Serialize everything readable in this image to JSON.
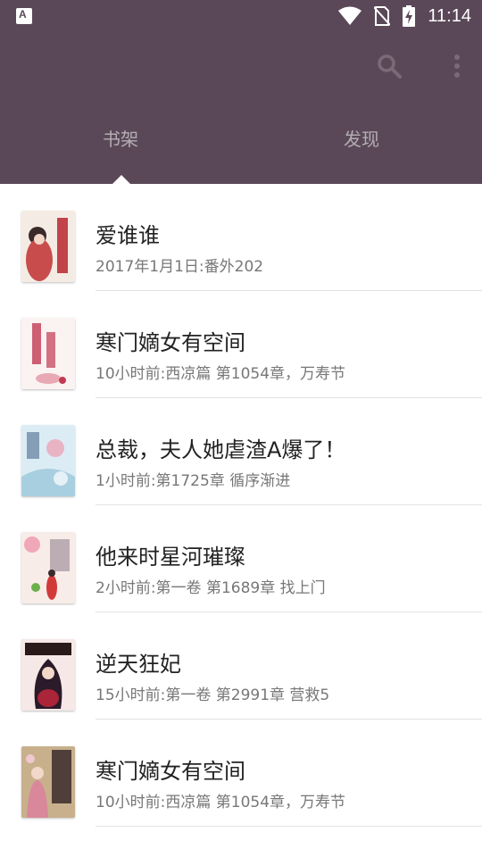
{
  "status_bar": {
    "time": "11:14",
    "app_badge": "A"
  },
  "toolbar": {
    "search_icon": "search-icon",
    "more_icon": "more-vert-icon"
  },
  "tabs": [
    {
      "label": "书架",
      "selected": true
    },
    {
      "label": "发现",
      "selected": false
    }
  ],
  "colors": {
    "header": "#5a4858",
    "title": "#222222",
    "subtitle": "#777777"
  },
  "books": [
    {
      "title": "爱谁谁",
      "latest": "2017年1月1日:番外202"
    },
    {
      "title": "寒门嫡女有空间",
      "latest": "10小时前:西凉篇 第1054章，万寿节"
    },
    {
      "title": "总裁，夫人她虐渣A爆了！",
      "latest": "1小时前:第1725章 循序渐进"
    },
    {
      "title": "他来时星河璀璨",
      "latest": "2小时前:第一卷 第1689章  找上门"
    },
    {
      "title": "逆天狂妃",
      "latest": "15小时前:第一卷 第2991章  营救5"
    },
    {
      "title": "寒门嫡女有空间",
      "latest": "10小时前:西凉篇 第1054章，万寿节"
    }
  ]
}
